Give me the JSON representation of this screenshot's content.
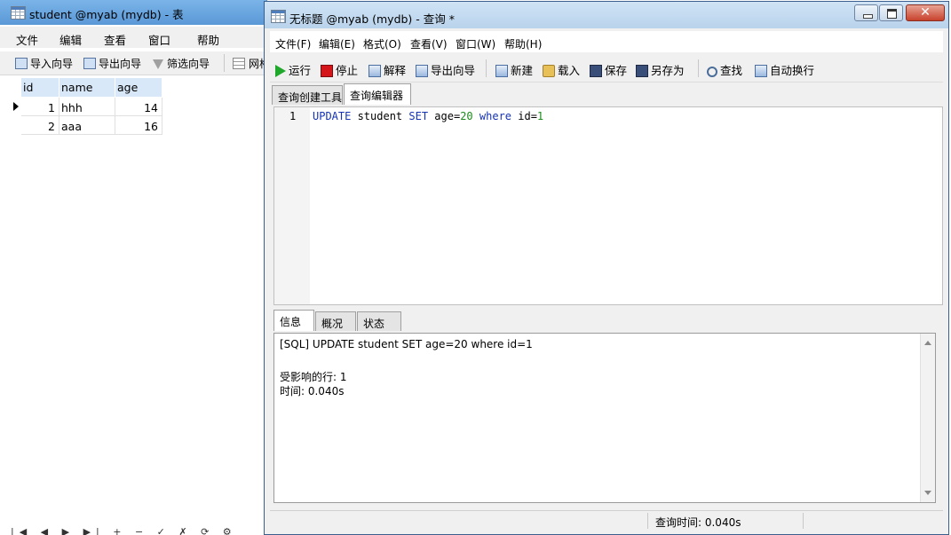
{
  "bg_window": {
    "title": "student @myab (mydb) - 表",
    "menu": [
      "文件",
      "编辑",
      "查看",
      "窗口",
      "帮助"
    ],
    "toolbar": [
      "导入向导",
      "导出向导",
      "筛选向导",
      "网格"
    ],
    "grid": {
      "columns": [
        "id",
        "name",
        "age"
      ],
      "rows": [
        {
          "id": "1",
          "name": "hhh",
          "age": "14"
        },
        {
          "id": "2",
          "name": "aaa",
          "age": "16"
        }
      ]
    },
    "nav_glyphs": "|◀ ◀ ▶ ▶| + − ✓ ✗ ⟳ ⚙"
  },
  "query_window": {
    "title": "无标题 @myab (mydb) - 查询 *",
    "controls": {
      "minimize": "minimize",
      "maximize": "maximize",
      "close": "✕"
    },
    "menu": {
      "file": "文件(F)",
      "edit": "编辑(E)",
      "format": "格式(O)",
      "view": "查看(V)",
      "window": "窗口(W)",
      "help": "帮助(H)"
    },
    "toolbar": {
      "run": "运行",
      "stop": "停止",
      "explain": "解释",
      "export": "导出向导",
      "new": "新建",
      "load": "载入",
      "save": "保存",
      "save_as": "另存为",
      "find": "查找",
      "word_wrap": "自动换行"
    },
    "tabs": {
      "builder": "查询创建工具",
      "editor": "查询编辑器"
    },
    "editor": {
      "line": "1",
      "tokens": {
        "update": "UPDATE",
        "table": " student ",
        "set": "SET",
        "assign": " age=",
        "value": "20",
        "space": " ",
        "where": "where",
        "cond": " id=",
        "cond_val": "1"
      }
    },
    "result_tabs": {
      "info": "信息",
      "overview": "概况",
      "status": "状态"
    },
    "messages": {
      "sql": "[SQL] UPDATE student SET age=20 where id=1",
      "affected": "受影响的行: 1",
      "time": "时间: 0.040s"
    },
    "statusbar": {
      "query_time": "查询时间: 0.040s"
    }
  }
}
